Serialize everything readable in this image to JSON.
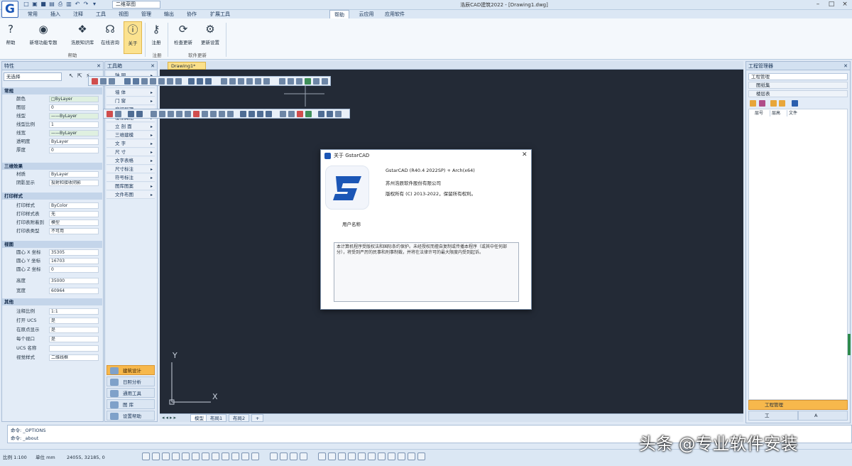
{
  "title_bar": {
    "workspace": "二维草图",
    "app_title": "浩辰CAD建筑2022 - [Drawing1.dwg]",
    "window_controls": [
      "–",
      "□",
      "×"
    ]
  },
  "menu": {
    "items": [
      "常用",
      "插入",
      "注释",
      "工具",
      "视图",
      "管理",
      "输出",
      "协作",
      "扩展工具",
      "帮助",
      "云应用",
      "应用软件"
    ],
    "active_label": "帮助",
    "tabs": [
      "常用",
      "插入",
      "注释",
      "工具",
      "视图",
      "管理",
      "输出",
      "协作",
      "扩展工具",
      "帮助",
      "云应用",
      "应用软件"
    ]
  },
  "ribbon": {
    "buttons": [
      "帮助",
      "新增功能专题",
      "浩辰知识库",
      "在线咨询",
      "关于",
      "注册",
      "检查更新",
      "更新设置"
    ],
    "groups": [
      "帮助",
      "注册",
      "软件更新"
    ]
  },
  "properties": {
    "title": "特性",
    "selector": "无选择",
    "sections": [
      {
        "name": "常规",
        "rows": [
          [
            "颜色",
            "□ByLayer"
          ],
          [
            "图层",
            "0"
          ],
          [
            "线型",
            "——ByLayer"
          ],
          [
            "线型比例",
            "1"
          ],
          [
            "线宽",
            "——ByLayer"
          ],
          [
            "透明度",
            "ByLayer"
          ],
          [
            "厚度",
            "0"
          ]
        ]
      },
      {
        "name": "三维效果",
        "rows": [
          [
            "材质",
            "ByLayer"
          ],
          [
            "阴影显示",
            "投射和接收阴影"
          ]
        ]
      },
      {
        "name": "打印样式",
        "rows": [
          [
            "打印样式",
            "ByColor"
          ],
          [
            "打印样式表",
            "无"
          ],
          [
            "打印表附着到",
            "模型"
          ],
          [
            "打印表类型",
            "不可用"
          ]
        ]
      },
      {
        "name": "视图",
        "rows": [
          [
            "圆心 X 坐标",
            "35305"
          ],
          [
            "圆心 Y 坐标",
            "16703"
          ],
          [
            "圆心 Z 坐标",
            "0"
          ],
          [
            "高度",
            "35000"
          ],
          [
            "宽度",
            "60964"
          ]
        ]
      },
      {
        "name": "其他",
        "rows": [
          [
            "注释比例",
            "1:1"
          ],
          [
            "打开 UCS",
            "是"
          ],
          [
            "在原点显示",
            "是"
          ],
          [
            "每个视口",
            "是"
          ],
          [
            "UCS 名称",
            ""
          ],
          [
            "视觉样式",
            "二维线框"
          ]
        ]
      }
    ]
  },
  "tool_panel": {
    "title": "工具箱",
    "items": [
      "轴 网",
      "柱 子",
      "墙 体",
      "门 窗",
      "房间屋顶",
      "楼梯其他",
      "立 剖 面",
      "三维建模",
      "文 字",
      "尺 寸",
      "文字表格",
      "尺寸标注",
      "符号标注",
      "图库图案",
      "文件布图"
    ],
    "nav": [
      "建筑设计",
      "日照分析",
      "通用工具",
      "图 库",
      "设置帮助"
    ]
  },
  "drawing": {
    "tab": "Drawing1*",
    "ucs_x": "X",
    "ucs_y": "Y",
    "layout_tabs": [
      "模型",
      "布局1",
      "布局2"
    ]
  },
  "dialog": {
    "title": "关于 GstarCAD",
    "version": "GstarCAD (R40.4 2022SP) + Arch(x64)",
    "company": "苏州浩辰软件股份有限公司",
    "copyright": "版权所有 (C) 2013-2022，保留所有权利。",
    "user_label": "用户名称",
    "license_text": "本计算机程序受版权法和国际条约保护。未经授权而擅自复制或传播本程序（或其中任何部分），将受到严厉的民事和刑事制裁，并将在法律许可的最大限度内受到起诉。"
  },
  "right_panel": {
    "title": "工程管理器",
    "dropdowns": [
      "工程管理",
      "图纸集",
      "楼层表"
    ],
    "columns": [
      "层号",
      "层高",
      "文件"
    ],
    "bottom_tabs": [
      "工程管理",
      "工",
      "A"
    ]
  },
  "command": {
    "lines": [
      "命令: _OPTIONS",
      "命令: _about"
    ]
  },
  "status": {
    "scale": "比例 1:100",
    "unit": "单位 mm",
    "coords": "24055, 32185, 0"
  },
  "watermark": "头条 @专业软件安装",
  "colors": {
    "canvas": "#232a36",
    "accent": "#f7b84c",
    "logo_blue": "#1b56b6"
  }
}
